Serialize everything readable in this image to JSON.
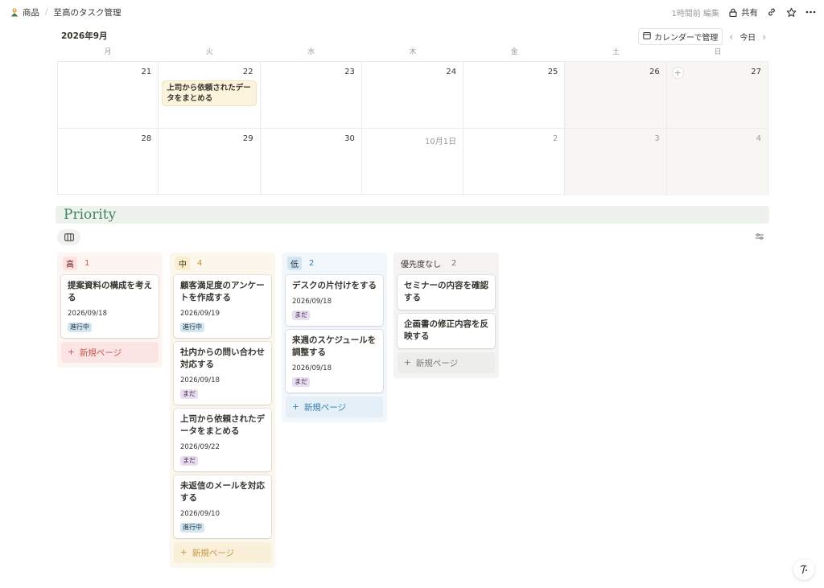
{
  "breadcrumb": {
    "workspace": "商品",
    "page": "至高のタスク管理"
  },
  "topbar": {
    "edited": "1時間前 編集",
    "share": "共有"
  },
  "calendar": {
    "month_label": "2026年9月",
    "manage_label": "カレンダーで管理",
    "today_label": "今日",
    "weekdays": [
      "月",
      "火",
      "水",
      "木",
      "金",
      "土",
      "日"
    ],
    "week1": [
      "21",
      "22",
      "23",
      "24",
      "25",
      "26",
      "27"
    ],
    "week2": [
      "28",
      "29",
      "30",
      "10月1日",
      "2",
      "3",
      "4"
    ],
    "event": "上司から依頼されたデータをまとめる"
  },
  "section_title": "Priority",
  "board": {
    "new_page": "新規ページ",
    "columns": [
      {
        "label": "高",
        "count": "1",
        "cards": [
          {
            "title": "提案資料の構成を考える",
            "date": "2026/09/18",
            "status": "進行中"
          }
        ]
      },
      {
        "label": "中",
        "count": "4",
        "cards": [
          {
            "title": "顧客満足度のアンケートを作成する",
            "date": "2026/09/19",
            "status": "進行中"
          },
          {
            "title": "社内からの問い合わせ対応する",
            "date": "2026/09/18",
            "status": "まだ"
          },
          {
            "title": "上司から依頼されたデータをまとめる",
            "date": "2026/09/22",
            "status": "まだ"
          },
          {
            "title": "未返信のメールを対応する",
            "date": "2026/09/10",
            "status": "進行中"
          }
        ]
      },
      {
        "label": "低",
        "count": "2",
        "cards": [
          {
            "title": "デスクの片付けをする",
            "date": "2026/09/18",
            "status": "まだ"
          },
          {
            "title": "来週のスケジュールを調整する",
            "date": "2026/09/18",
            "status": "まだ"
          }
        ]
      },
      {
        "label": "優先度なし",
        "count": "2",
        "cards": [
          {
            "title": "セミナーの内容を確認する"
          },
          {
            "title": "企画書の修正内容を反映する"
          }
        ]
      }
    ]
  },
  "colors": {
    "accent_green": "#448361",
    "high_red": "#c4554d",
    "mid_yellow": "#c29343",
    "low_blue": "#337ea9"
  }
}
